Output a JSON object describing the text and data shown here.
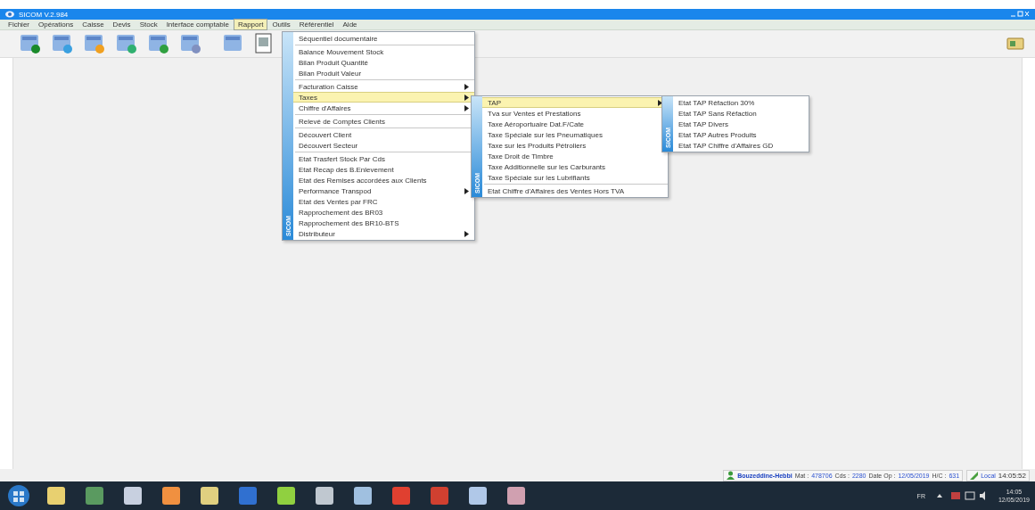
{
  "window": {
    "title": "SICOM V.2.984"
  },
  "menubar": [
    {
      "label": "Fichier",
      "selected": false
    },
    {
      "label": "Opérations",
      "selected": false
    },
    {
      "label": "Caisse",
      "selected": false
    },
    {
      "label": "Devis",
      "selected": false
    },
    {
      "label": "Stock",
      "selected": false
    },
    {
      "label": "Interface comptable",
      "selected": false
    },
    {
      "label": "Rapport",
      "selected": true
    },
    {
      "label": "Outils",
      "selected": false
    },
    {
      "label": "Référentiel",
      "selected": false
    },
    {
      "label": "Aide",
      "selected": false
    }
  ],
  "menus": [
    {
      "band": "SICOM",
      "items": [
        {
          "kind": "item",
          "label": "Séquentiel documentaire",
          "submenu": false,
          "selected": false
        },
        {
          "kind": "separator"
        },
        {
          "kind": "item",
          "label": "Balance Mouvement Stock",
          "submenu": false,
          "selected": false
        },
        {
          "kind": "item",
          "label": "Bilan Produit Quantité",
          "submenu": false,
          "selected": false
        },
        {
          "kind": "item",
          "label": "Bilan Produit Valeur",
          "submenu": false,
          "selected": false
        },
        {
          "kind": "separator"
        },
        {
          "kind": "item",
          "label": "Facturation Caisse",
          "submenu": true,
          "selected": false
        },
        {
          "kind": "item",
          "label": "Taxes",
          "submenu": true,
          "selected": true
        },
        {
          "kind": "item",
          "label": "Chiffre d'Affaires",
          "submenu": true,
          "selected": false
        },
        {
          "kind": "separator"
        },
        {
          "kind": "item",
          "label": "Relevé de Comptes Clients",
          "submenu": false,
          "selected": false
        },
        {
          "kind": "separator"
        },
        {
          "kind": "item",
          "label": "Découvert Client",
          "submenu": false,
          "selected": false
        },
        {
          "kind": "item",
          "label": "Découvert Secteur",
          "submenu": false,
          "selected": false
        },
        {
          "kind": "separator"
        },
        {
          "kind": "item",
          "label": "Etat Trasfert Stock Par Cds",
          "submenu": false,
          "selected": false
        },
        {
          "kind": "item",
          "label": "Etat Recap des B.Enlevement",
          "submenu": false,
          "selected": false
        },
        {
          "kind": "item",
          "label": "Etat des Remises accordées aux Clients",
          "submenu": false,
          "selected": false
        },
        {
          "kind": "item",
          "label": "Performance Transpod",
          "submenu": true,
          "selected": false
        },
        {
          "kind": "item",
          "label": "Etat des Ventes par FRC",
          "submenu": false,
          "selected": false
        },
        {
          "kind": "item",
          "label": "Rapprochement des BR03",
          "submenu": false,
          "selected": false
        },
        {
          "kind": "item",
          "label": "Rapprochement des BR10-BTS",
          "submenu": false,
          "selected": false
        },
        {
          "kind": "item",
          "label": "Distributeur",
          "submenu": true,
          "selected": false
        }
      ]
    },
    {
      "band": "SICOM",
      "items": [
        {
          "kind": "item",
          "label": "TAP",
          "submenu": true,
          "selected": true
        },
        {
          "kind": "item",
          "label": "Tva sur Ventes et Prestations",
          "submenu": false,
          "selected": false
        },
        {
          "kind": "item",
          "label": "Taxe Aéroportuaire Dat.F/Cate",
          "submenu": false,
          "selected": false
        },
        {
          "kind": "item",
          "label": "Taxe Spéciale sur les Pneumatiques",
          "submenu": false,
          "selected": false
        },
        {
          "kind": "item",
          "label": "Taxe sur les Produits Pétroliers",
          "submenu": false,
          "selected": false
        },
        {
          "kind": "item",
          "label": "Taxe Droit de Timbre",
          "submenu": false,
          "selected": false
        },
        {
          "kind": "item",
          "label": "Taxe Additionnelle sur les Carburants",
          "submenu": false,
          "selected": false
        },
        {
          "kind": "item",
          "label": "Taxe Spéciale sur les Lubrifiants",
          "submenu": false,
          "selected": false
        },
        {
          "kind": "separator"
        },
        {
          "kind": "item",
          "label": "Etat Chiffre d'Affaires des Ventes Hors TVA",
          "submenu": false,
          "selected": false
        }
      ]
    },
    {
      "band": "SICOM",
      "items": [
        {
          "kind": "item",
          "label": "Etat TAP Réfaction 30%",
          "submenu": false,
          "selected": false
        },
        {
          "kind": "item",
          "label": "Etat TAP Sans Réfaction",
          "submenu": false,
          "selected": false
        },
        {
          "kind": "item",
          "label": "Etat TAP Divers",
          "submenu": false,
          "selected": false
        },
        {
          "kind": "item",
          "label": "Etat TAP Autres Produits",
          "submenu": false,
          "selected": false
        },
        {
          "kind": "item",
          "label": "Etat TAP Chiffre d'Affaires GD",
          "submenu": false,
          "selected": false
        }
      ]
    }
  ],
  "status_bar": {
    "user": "Bouzeddine-Hebbi",
    "fields": [
      {
        "label": "Mat :",
        "value": "478706"
      },
      {
        "label": "Cds :",
        "value": "2280"
      },
      {
        "label": "Date Op :",
        "value": "12/05/2019"
      },
      {
        "label": "H/C :",
        "value": "631"
      }
    ],
    "mode": "Local",
    "time": "14:05:52"
  },
  "taskbar": {
    "language": "FR",
    "clock_time": "14:05",
    "clock_date": "12/05/2019"
  }
}
